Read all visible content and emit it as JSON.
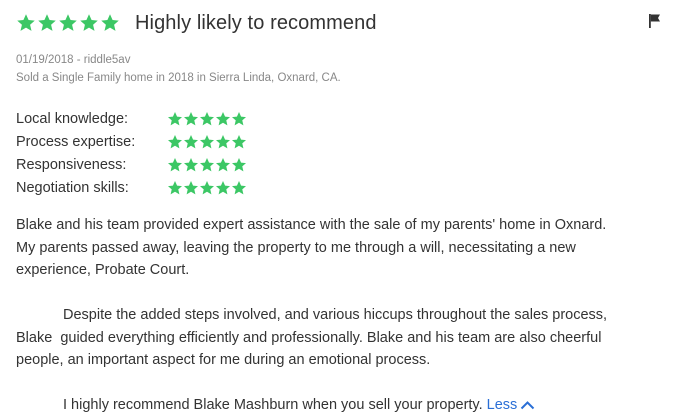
{
  "review": {
    "overall_rating": 5,
    "overall_rating_max": 5,
    "title": "Highly likely to recommend",
    "flag_icon": "flag-icon",
    "date_user": "01/19/2018 - riddle5av",
    "transaction": "Sold a Single Family home in 2018 in Sierra Linda, Oxnard, CA.",
    "star_color": "#3cc765",
    "ratings": [
      {
        "label": "Local knowledge:",
        "value": 5
      },
      {
        "label": "Process expertise:",
        "value": 5
      },
      {
        "label": "Responsiveness:",
        "value": 5
      },
      {
        "label": "Negotiation skills:",
        "value": 5
      }
    ],
    "paragraph_1_line_1": "Blake and his team provided expert assistance with the sale of my parents' home in Oxnard.",
    "paragraph_1_line_2": "My parents passed away, leaving the property to me through a will, necessitating a new",
    "paragraph_1_line_3": "experience, Probate Court.",
    "paragraph_2_line_1": "Despite the added steps involved, and various hiccups throughout the sales process,",
    "paragraph_2_line_2": "Blake  guided everything efficiently and professionally. Blake and his team are also cheerful",
    "paragraph_2_line_3": "people, an important aspect for me during an emotional process.",
    "paragraph_3": "I highly recommend Blake Mashburn when you sell your property.",
    "less_label": "Less",
    "less_icon": "chevron-up-icon",
    "link_color": "#2a6fd6"
  }
}
